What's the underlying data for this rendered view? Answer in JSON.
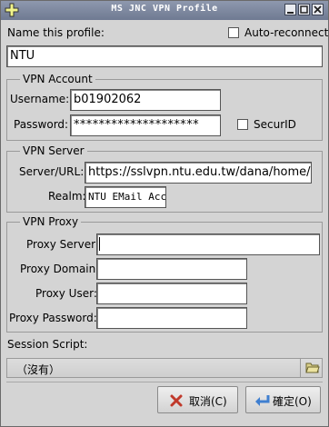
{
  "window": {
    "title": "MS JNC VPN Profile"
  },
  "profile": {
    "name_label": "Name this profile:",
    "name_value": "NTU",
    "auto_reconnect_label": "Auto-reconnect",
    "auto_reconnect_checked": false
  },
  "vpn_account": {
    "group_label": "VPN Account",
    "username_label": "Username:",
    "username_value": "b01902062",
    "password_label": "Password:",
    "password_value": "********************",
    "securid_label": "SecurID",
    "securid_checked": false
  },
  "vpn_server": {
    "group_label": "VPN Server",
    "server_label": "Server/URL:",
    "server_value": "https://sslvpn.ntu.edu.tw/dana/home/index.cgi",
    "realm_label": "Realm:",
    "realm_value": "NTU EMail Account"
  },
  "vpn_proxy": {
    "group_label": "VPN Proxy",
    "server_label": "Proxy Server:",
    "server_value": "",
    "domain_label": "Proxy Domain:",
    "domain_value": "",
    "user_label": "Proxy User:",
    "user_value": "",
    "password_label": "Proxy Password:",
    "password_value": ""
  },
  "session_script": {
    "label": "Session Script:",
    "value": "（沒有）"
  },
  "buttons": {
    "cancel_label": "取消(C)",
    "ok_label": "確定(O)"
  },
  "colors": {
    "titlebar": "#7a849b",
    "background": "#d4d4d4",
    "cancel_icon": "#c0392b",
    "ok_icon": "#3f7fd0"
  }
}
